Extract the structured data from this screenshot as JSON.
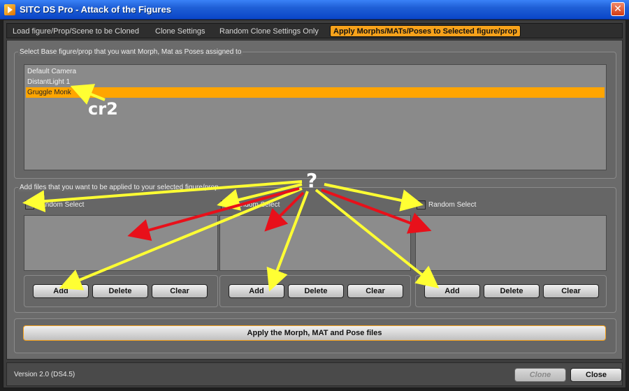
{
  "window": {
    "title": "SITC DS Pro - Attack of the Figures",
    "close_glyph": "✕"
  },
  "tabs": [
    {
      "label": "Load figure/Prop/Scene to be Cloned",
      "active": false
    },
    {
      "label": "Clone Settings",
      "active": false
    },
    {
      "label": "Random Clone Settings Only",
      "active": false
    },
    {
      "label": "Apply Morphs/MATs/Poses to Selected figure/prop",
      "active": true
    }
  ],
  "base_select": {
    "label": "Select Base figure/prop that you want Morph, Mat as Poses assigned to",
    "items": [
      {
        "label": "Default Camera",
        "selected": false
      },
      {
        "label": "DistantLight 1",
        "selected": false
      },
      {
        "label": "Gruggle Monk",
        "selected": true
      }
    ]
  },
  "files": {
    "label": "Add files that you want to be applied to your selected figure/prop",
    "columns": [
      {
        "random_label": "Random Select",
        "add": "Add",
        "delete": "Delete",
        "clear": "Clear"
      },
      {
        "random_label": "Random Select",
        "add": "Add",
        "delete": "Delete",
        "clear": "Clear"
      },
      {
        "random_label": "Random Select",
        "add": "Add",
        "delete": "Delete",
        "clear": "Clear"
      }
    ]
  },
  "apply_button": "Apply the Morph, MAT and Pose files",
  "status": {
    "version": "Version 2.0 (DS4.5)",
    "clone": "Clone",
    "close": "Close"
  },
  "annotations": {
    "cr2": "cr2",
    "question": "?"
  },
  "colors": {
    "accent": "#f7a21b",
    "arrow_yellow": "#ffff33",
    "arrow_red": "#e8101a"
  }
}
